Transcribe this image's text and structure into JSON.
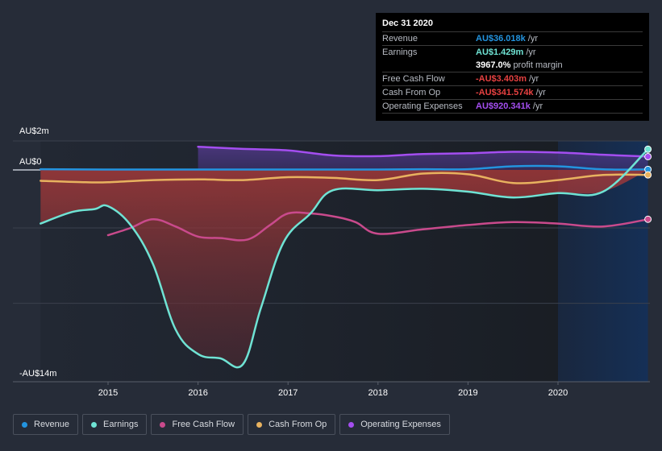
{
  "tooltip": {
    "date": "Dec 31 2020",
    "rows": [
      {
        "key": "Revenue",
        "value": "AU$36.018k",
        "unit": "/yr",
        "color": "#2394df"
      },
      {
        "key": "Earnings",
        "value": "AU$1.429m",
        "unit": "/yr",
        "color": "#6fe3d4"
      },
      {
        "key": "",
        "value": "3967.0%",
        "unit": "profit margin",
        "color": "#ffffff"
      },
      {
        "key": "Free Cash Flow",
        "value": "-AU$3.403m",
        "unit": "/yr",
        "color": "#e64141"
      },
      {
        "key": "Cash From Op",
        "value": "-AU$341.574k",
        "unit": "/yr",
        "color": "#e64141"
      },
      {
        "key": "Operating Expenses",
        "value": "AU$920.341k",
        "unit": "/yr",
        "color": "#a44ef0"
      }
    ]
  },
  "legend": [
    {
      "label": "Revenue",
      "color": "#2394df"
    },
    {
      "label": "Earnings",
      "color": "#6fe3d4"
    },
    {
      "label": "Free Cash Flow",
      "color": "#c94a8c"
    },
    {
      "label": "Cash From Op",
      "color": "#e8b25f"
    },
    {
      "label": "Operating Expenses",
      "color": "#a44ef0"
    }
  ],
  "chart_data": {
    "type": "line",
    "title": "",
    "xlabel": "",
    "ylabel": "",
    "x_ticks": [
      "2015",
      "2016",
      "2017",
      "2018",
      "2019",
      "2020"
    ],
    "y_tick_labels": [
      "AU$2m",
      "AU$0",
      "-AU$14m"
    ],
    "y_ticks": [
      2,
      0,
      -14
    ],
    "ylim": [
      -14.5,
      2
    ],
    "xlim": [
      2014.25,
      2021.0
    ],
    "grid": true,
    "highlight_region": [
      2020.0,
      2021.0
    ],
    "series": [
      {
        "name": "Revenue",
        "color": "#2394df",
        "x": [
          2014.25,
          2015.0,
          2016.0,
          2017.0,
          2018.0,
          2018.5,
          2019.0,
          2019.5,
          2020.0,
          2020.5,
          2021.0
        ],
        "y": [
          0.05,
          0.03,
          0.03,
          0.03,
          0.03,
          0.05,
          0.05,
          0.25,
          0.25,
          0.04,
          0.036
        ]
      },
      {
        "name": "Earnings",
        "color": "#6fe3d4",
        "x": [
          2014.25,
          2014.6,
          2014.85,
          2015.0,
          2015.25,
          2015.5,
          2015.75,
          2016.0,
          2016.25,
          2016.5,
          2016.7,
          2016.95,
          2017.25,
          2017.5,
          2018.0,
          2018.5,
          2019.0,
          2019.5,
          2020.0,
          2020.5,
          2021.0
        ],
        "y": [
          -3.7,
          -2.9,
          -2.7,
          -2.5,
          -3.8,
          -6.5,
          -11.0,
          -12.7,
          -13.0,
          -13.4,
          -9.5,
          -5.0,
          -3.0,
          -1.4,
          -1.4,
          -1.3,
          -1.5,
          -1.9,
          -1.6,
          -1.5,
          1.429
        ]
      },
      {
        "name": "Free Cash Flow",
        "color": "#c94a8c",
        "x": [
          2015.0,
          2015.25,
          2015.5,
          2015.75,
          2016.0,
          2016.25,
          2016.55,
          2016.8,
          2017.0,
          2017.25,
          2017.5,
          2017.75,
          2018.0,
          2018.5,
          2019.0,
          2019.5,
          2020.0,
          2020.5,
          2021.0
        ],
        "y": [
          -4.5,
          -4.0,
          -3.4,
          -3.9,
          -4.6,
          -4.7,
          -4.8,
          -3.8,
          -3.0,
          -3.0,
          -3.2,
          -3.6,
          -4.4,
          -4.1,
          -3.8,
          -3.6,
          -3.7,
          -3.9,
          -3.403
        ]
      },
      {
        "name": "Cash From Op",
        "color": "#e8b25f",
        "x": [
          2014.25,
          2014.75,
          2015.0,
          2015.5,
          2016.0,
          2016.5,
          2017.0,
          2017.5,
          2018.0,
          2018.5,
          2019.0,
          2019.5,
          2020.0,
          2020.5,
          2021.0
        ],
        "y": [
          -0.75,
          -0.85,
          -0.85,
          -0.7,
          -0.65,
          -0.7,
          -0.5,
          -0.55,
          -0.7,
          -0.25,
          -0.3,
          -0.9,
          -0.7,
          -0.35,
          -0.342
        ]
      },
      {
        "name": "Operating Expenses",
        "color": "#a44ef0",
        "x": [
          2016.0,
          2016.5,
          2017.0,
          2017.5,
          2018.0,
          2018.5,
          2019.0,
          2019.5,
          2020.0,
          2020.5,
          2021.0
        ],
        "y": [
          1.6,
          1.45,
          1.35,
          1.0,
          0.95,
          1.1,
          1.15,
          1.25,
          1.2,
          1.05,
          0.92
        ]
      }
    ]
  }
}
